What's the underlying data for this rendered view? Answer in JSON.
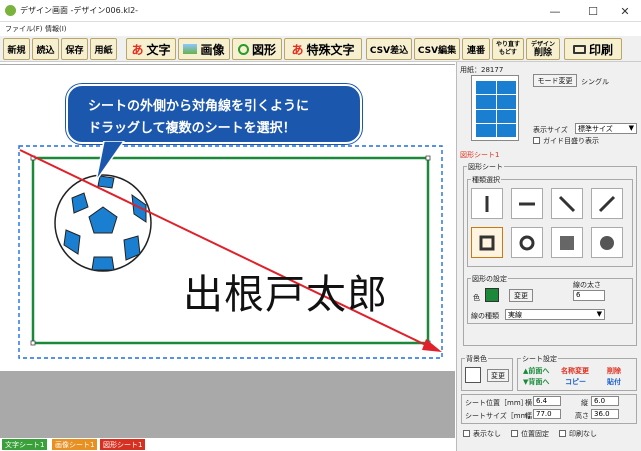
{
  "window": {
    "title": "デザイン画面 -デザイン006.kl2-",
    "minimize": "—",
    "maximize": "☐",
    "close": "✕"
  },
  "menu": [
    "ファイル(F)",
    "情報(I)"
  ],
  "toolbar": {
    "new": "新規",
    "open": "読込",
    "save": "保存",
    "paper": "用紙",
    "text": "文字",
    "text_icon": "あ",
    "image": "画像",
    "shape": "図形",
    "special_text": "特殊文字",
    "special_icon": "あ",
    "csv_insert": "CSV差込",
    "csv_edit": "CSV編集",
    "serial": "連番",
    "undo": "やり直す",
    "redo": "もどす",
    "design_delete_top": "デザイン",
    "design_delete": "削除",
    "print": "印刷"
  },
  "callout": {
    "line1": "シートの外側から対角線を引くように",
    "line2": "ドラッグして複数のシートを選択！"
  },
  "canvas": {
    "name_text": "出根戸太郎"
  },
  "status_tabs": [
    {
      "label": "文字シート1",
      "color": "#3aa03a"
    },
    {
      "label": "画像シート1",
      "color": "#e89020"
    },
    {
      "label": "図形シート1",
      "color": "#d83020"
    }
  ],
  "panel": {
    "paper_label": "用紙：28177",
    "mode_button": "モード変更",
    "mode_value": "シングル",
    "display_size_label": "表示サイズ",
    "display_size_value": "標準サイズ",
    "guide_label": "ガイド目盛り表示",
    "sheet_name": "図形シート1",
    "shape_sheet_group": "図形シート",
    "type_group": "種類選択",
    "settings_group": "図形の設定",
    "color_label": "色",
    "change_button": "変更",
    "line_width_label": "線の太さ",
    "line_width_value": "6",
    "line_type_label": "線の種類",
    "line_type_value": "実線",
    "bg_label": "背景色",
    "bg_change": "変更",
    "sheet_settings_label": "シート設定",
    "front": "▲前面へ",
    "back": "▼背面へ",
    "rename": "名称変更",
    "copy": "コピー",
    "delete": "削除",
    "paste": "貼付",
    "pos_label": "シート位置［mm］",
    "pos_x_label": "横",
    "pos_x": "6.4",
    "pos_y_label": "縦",
    "pos_y": "6.0",
    "size_label": "シートサイズ［mm］",
    "width_label": "幅",
    "width": "77.0",
    "height_label": "高さ",
    "height": "36.0",
    "hide": "表示なし",
    "lock": "位置固定",
    "noprint": "印刷なし"
  },
  "colors": {
    "shape_color": "#1a8a3a",
    "toolbar_bg": "#f7f0d0",
    "callout": "#1c57ae",
    "arrow": "#e0202a"
  }
}
